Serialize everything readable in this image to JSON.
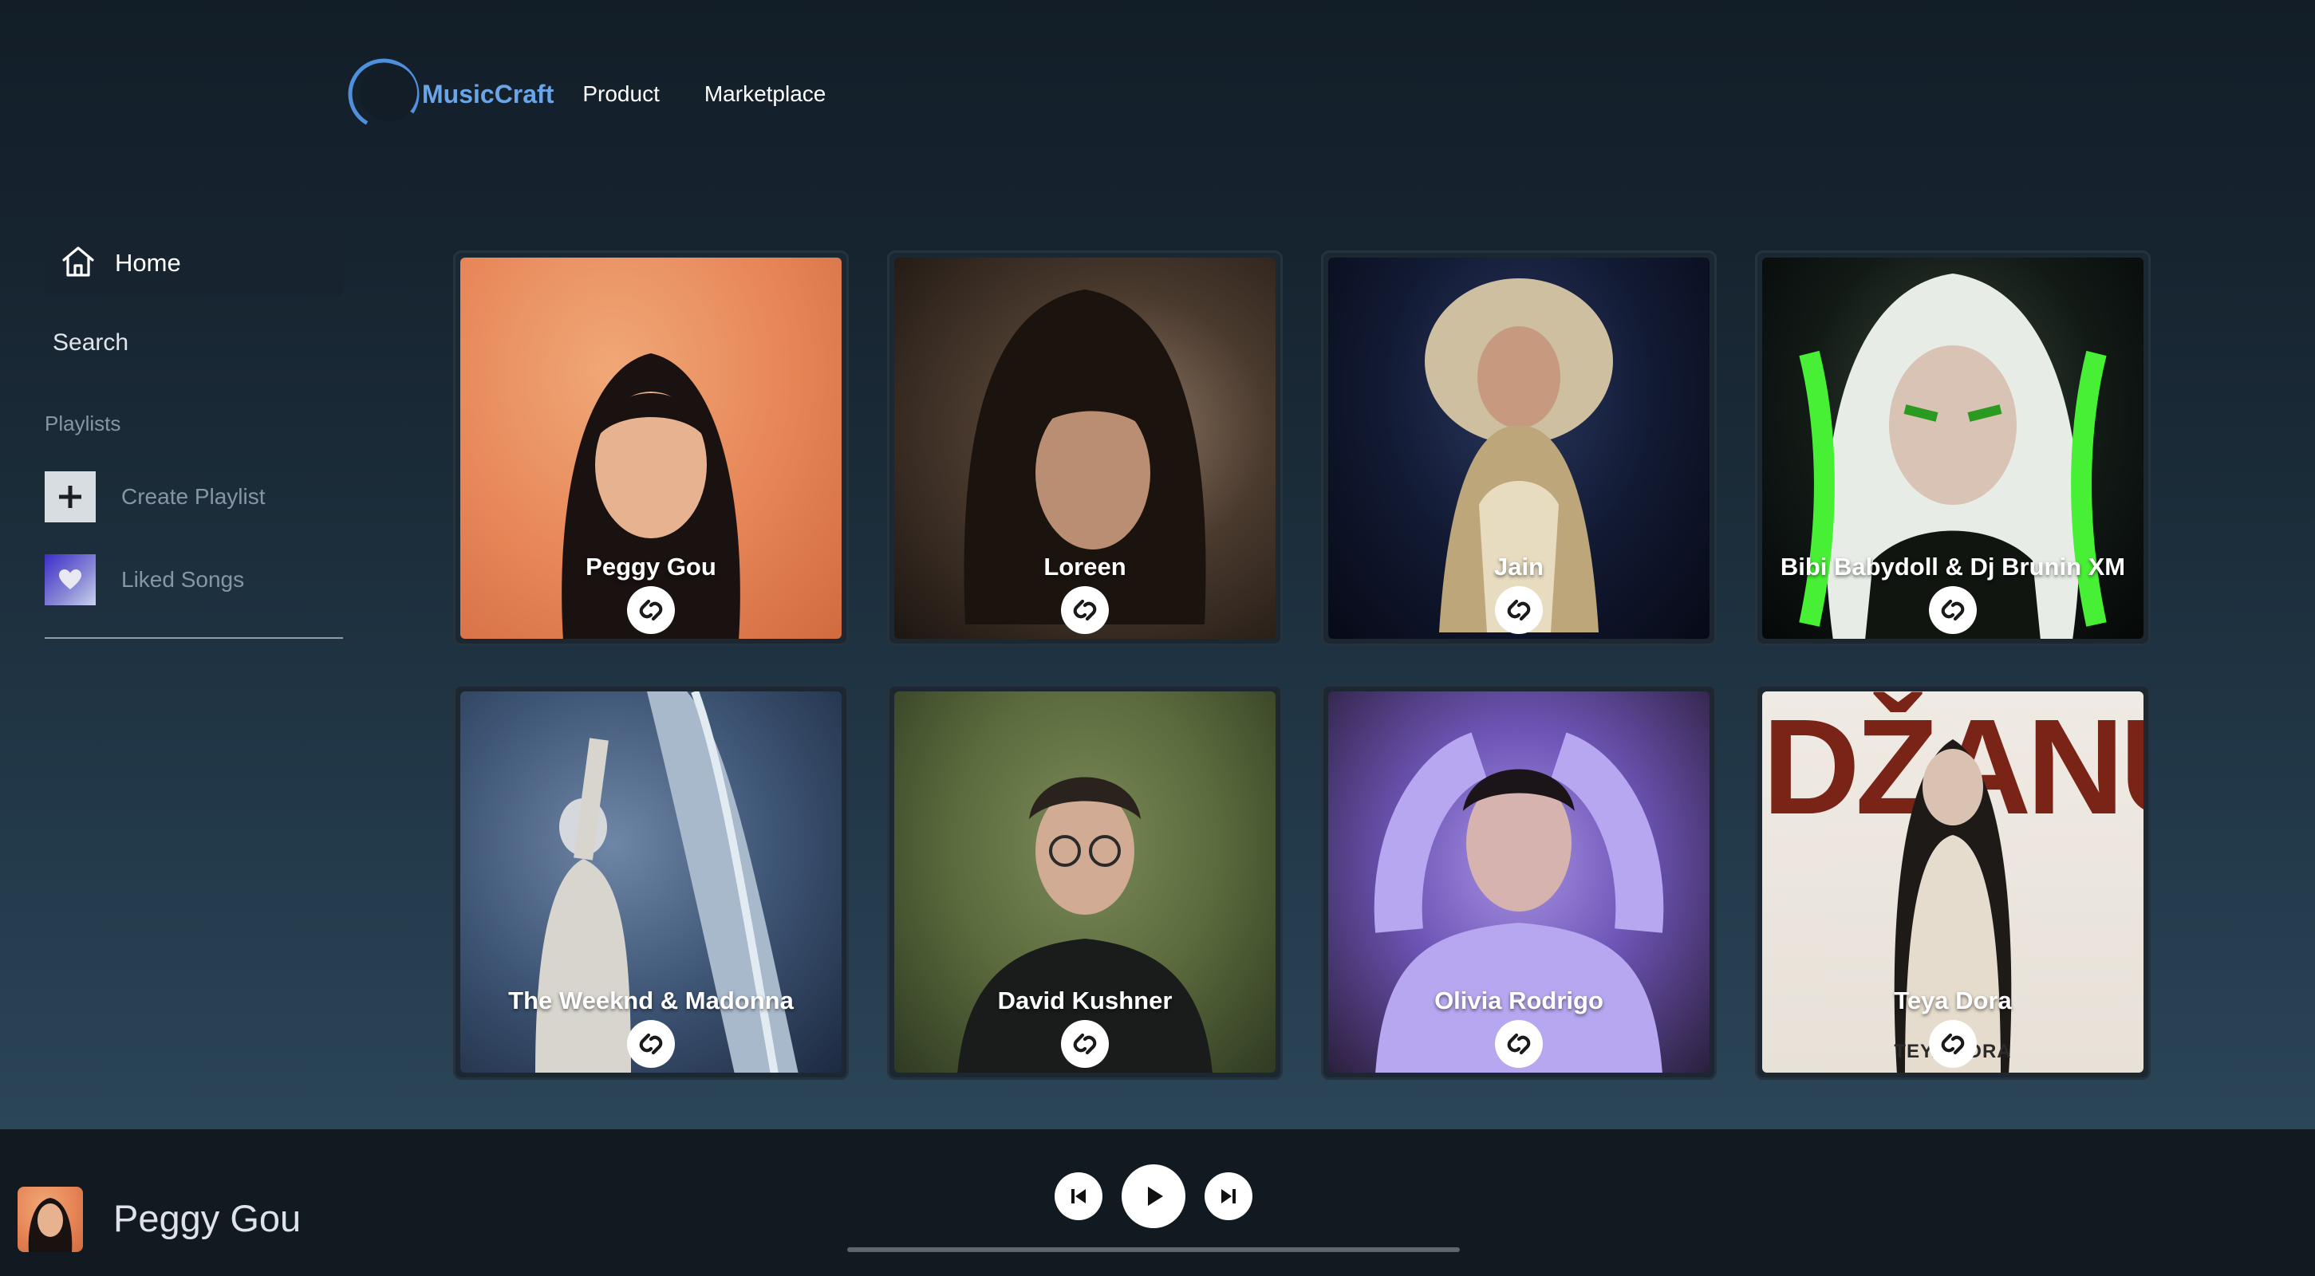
{
  "header": {
    "brand": "MusicCraft",
    "nav": [
      "Product",
      "Marketplace"
    ]
  },
  "sidebar": {
    "home_label": "Home",
    "search_label": "Search",
    "section_title": "Playlists",
    "create_playlist_label": "Create Playlist",
    "liked_songs_label": "Liked Songs"
  },
  "cards": [
    {
      "name": "Peggy Gou"
    },
    {
      "name": "Loreen"
    },
    {
      "name": "Jain"
    },
    {
      "name": "Bibi Babydoll & Dj Brunin XM"
    },
    {
      "name": "The Weeknd & Madonna"
    },
    {
      "name": "David Kushner"
    },
    {
      "name": "Olivia Rodrigo"
    },
    {
      "name": "Teya Dora",
      "cover_text": "DŽANUM",
      "cover_footer": "TEYA DORA"
    }
  ],
  "player": {
    "now_playing": "Peggy Gou",
    "progress_fraction": 0.0
  },
  "colors": {
    "brand": "#6aa5e8",
    "background_top": "#121d27",
    "background_bottom": "#2f4c5f",
    "player_bar": "#121a21"
  },
  "icons": [
    "logo-icon",
    "home-icon",
    "plus-icon",
    "heart-icon",
    "shazam-icon",
    "previous-icon",
    "play-icon",
    "next-icon"
  ]
}
